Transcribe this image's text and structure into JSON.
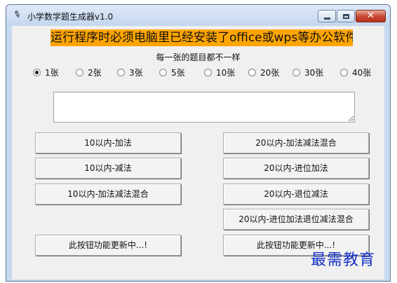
{
  "window": {
    "title": "小学数学题生成器v1.0",
    "app_icon": "feather-icon",
    "controls": {
      "minimize": "minimize-icon",
      "maximize": "maximize-icon",
      "close": "close-icon",
      "close_glyph": "✕"
    }
  },
  "banner": {
    "text": "运行程序时必须电脑里已经安装了office或wps等办公软件",
    "background": "#ffa500"
  },
  "subtitle": "每一张的题目都不一样",
  "sheet_options": [
    {
      "label": "1张",
      "selected": true
    },
    {
      "label": "2张",
      "selected": false
    },
    {
      "label": "3张",
      "selected": false
    },
    {
      "label": "5张",
      "selected": false
    },
    {
      "label": "10张",
      "selected": false
    },
    {
      "label": "20张",
      "selected": false
    },
    {
      "label": "30张",
      "selected": false
    },
    {
      "label": "40张",
      "selected": false
    }
  ],
  "output_text": {
    "value": ""
  },
  "buttons": {
    "left": [
      "10以内-加法",
      "10以内-减法",
      "10以内-加法减法混合",
      "此按钮功能更新中...!"
    ],
    "right": [
      "20以内-加法减法混合",
      "20以内-进位加法",
      "20以内-退位减法",
      "20以内-进位加法退位减法混合",
      "此按钮功能更新中...!"
    ]
  },
  "watermark": {
    "text": "最需教育",
    "color": "#1530c8"
  }
}
